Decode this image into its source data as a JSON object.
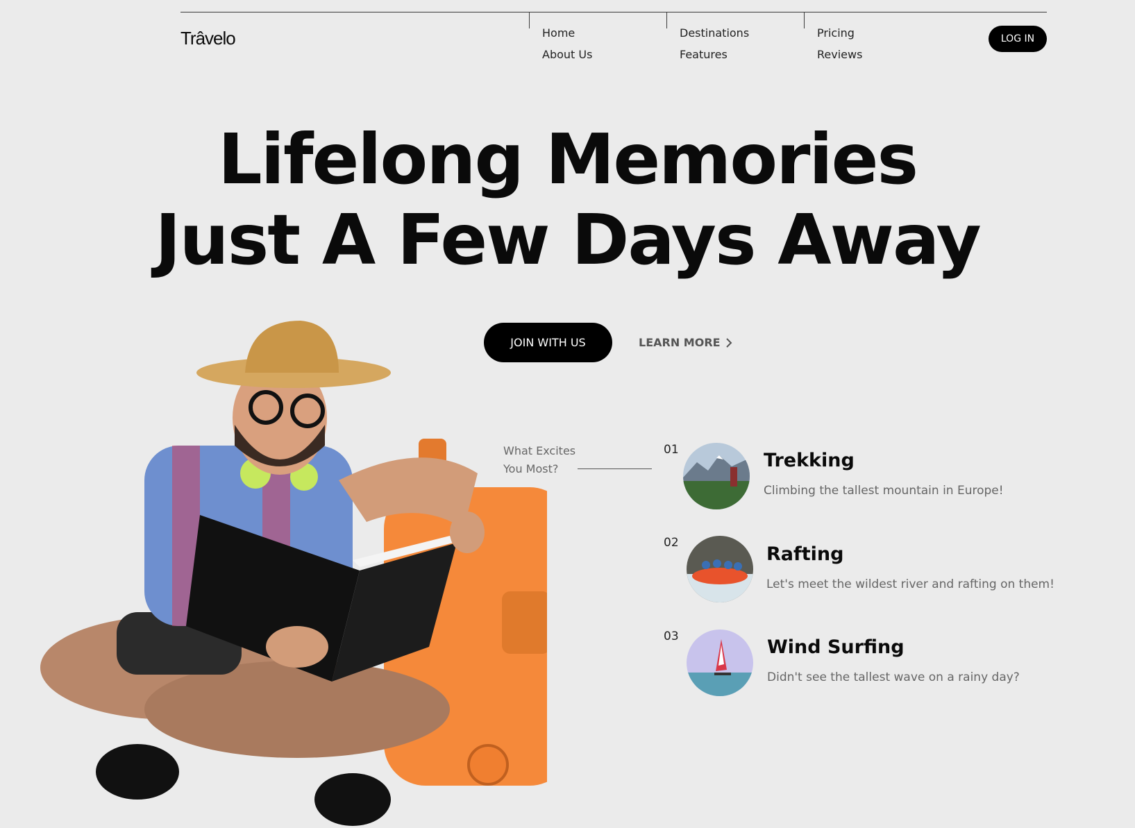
{
  "logo": "Trâvelo",
  "nav": {
    "col1": [
      "Home",
      "About Us"
    ],
    "col2": [
      "Destinations",
      "Features"
    ],
    "col3": [
      "Pricing",
      "Reviews"
    ]
  },
  "login_label": "LOG IN",
  "hero": {
    "line1": "Lifelong Memories",
    "line2": "Just A Few Days Away"
  },
  "cta": {
    "join_label": "JOIN WITH US",
    "learn_label": "LEARN MORE"
  },
  "excites": {
    "line1": "What Excites",
    "line2": "You Most?"
  },
  "activities": [
    {
      "num": "01",
      "title": "Trekking",
      "desc": "Climbing the tallest mountain in Europe!",
      "icon": "trekking-image"
    },
    {
      "num": "02",
      "title": "Rafting",
      "desc": "Let's meet the wildest river and rafting on them!",
      "icon": "rafting-image"
    },
    {
      "num": "03",
      "title": "Wind Surfing",
      "desc": "Didn't see the tallest wave on a rainy day?",
      "icon": "windsurfing-image"
    }
  ],
  "colors": {
    "background": "#ebebeb",
    "button": "#000000",
    "suitcase": "#f5893a"
  }
}
